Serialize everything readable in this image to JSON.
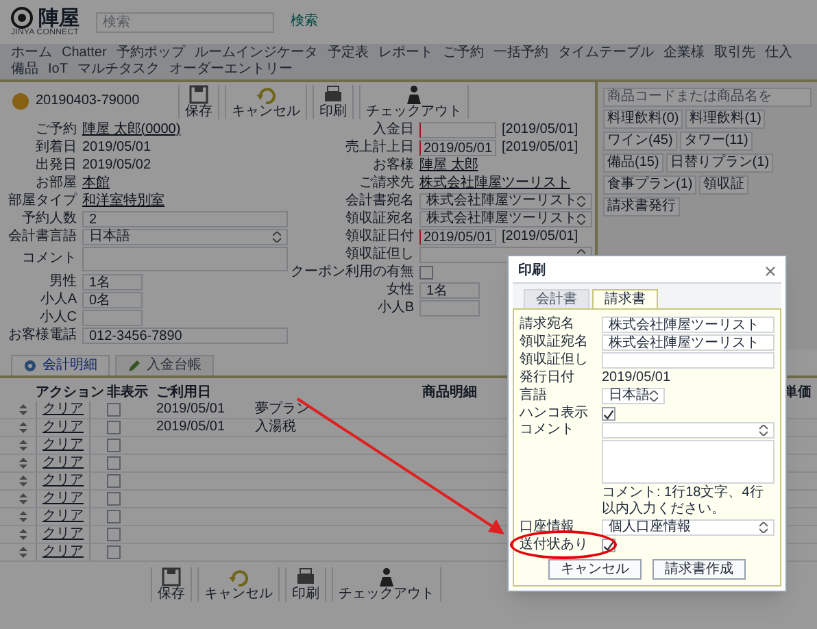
{
  "header": {
    "logo_text": "陣屋",
    "logo_subtitle": "JINYA CONNECT",
    "search": {
      "placeholder": "検索"
    },
    "search_button": "検索"
  },
  "nav": [
    "ホーム",
    "Chatter",
    "予約ポップ",
    "ルームインジケータ",
    "予定表",
    "レポート",
    "ご予約",
    "一括予約",
    "タイムテーブル",
    "企業様",
    "取引先",
    "仕入",
    "備品",
    "IoT",
    "マルチタスク",
    "オーダーエントリー"
  ],
  "record": {
    "number": "20190403-79000"
  },
  "toolbar": [
    "保存",
    "キャンセル",
    "印刷",
    "チェックアウト"
  ],
  "form_left": [
    {
      "label": "ご予約",
      "kind": "link",
      "value": "陣屋 太郎(0000)"
    },
    {
      "label": "到着日",
      "kind": "text",
      "value": "2019/05/01"
    },
    {
      "label": "出発日",
      "kind": "text",
      "value": "2019/05/02"
    },
    {
      "label": "お部屋",
      "kind": "link",
      "value": "本館"
    },
    {
      "label": "部屋タイプ",
      "kind": "link",
      "value": "和洋室特別室"
    },
    {
      "label": "予約人数",
      "kind": "input",
      "value": "2"
    },
    {
      "label": "会計書言語",
      "kind": "select",
      "value": "日本語"
    },
    {
      "label": "コメント",
      "kind": "textarea"
    },
    {
      "label": "男性",
      "kind": "input",
      "value": "1名"
    },
    {
      "label": "小人A",
      "kind": "input",
      "value": "0名"
    },
    {
      "label": "小人C",
      "kind": "input"
    },
    {
      "label": "お客様電話",
      "kind": "input",
      "value": "012-3456-7890"
    }
  ],
  "form_right": [
    {
      "label": "入金日",
      "kind": "date",
      "button": "[2019/05/01]"
    },
    {
      "label": "売上計上日",
      "kind": "date",
      "value": "2019/05/01",
      "button": "[2019/05/01]"
    },
    {
      "label": "お客様",
      "kind": "link",
      "value": "陣屋 太郎"
    },
    {
      "label": "ご請求先",
      "kind": "link",
      "value": "株式会社陣屋ツーリスト"
    },
    {
      "label": "会計書宛名",
      "kind": "select",
      "value": "株式会社陣屋ツーリスト"
    },
    {
      "label": "領収証宛名",
      "kind": "select",
      "value": "株式会社陣屋ツーリスト"
    },
    {
      "label": "領収証日付",
      "kind": "date",
      "value": "2019/05/01",
      "button": "[2019/05/01]"
    },
    {
      "label": "領収証但し",
      "kind": "select"
    },
    {
      "label": "クーポン利用の有無",
      "kind": "checkbox",
      "checked": false
    },
    {
      "label": "女性",
      "kind": "input",
      "value": "1名"
    },
    {
      "label": "小人B",
      "kind": "input"
    }
  ],
  "product_panel": {
    "hint": "商品コードまたは商品名を",
    "buttons": [
      "料理飲料(0)",
      "料理飲料(1)",
      "ワイン(45)",
      "タワー(11)",
      "備品(15)",
      "日替りプラン(1)",
      "食事プラン(1)",
      "領収証",
      "請求書発行"
    ]
  },
  "detail_tabs": [
    {
      "label": "会計明細",
      "selected": true
    },
    {
      "label": "入金台帳",
      "selected": false
    }
  ],
  "table": {
    "columns": [
      "アクション",
      "非表示",
      "ご利用日",
      "商品明細",
      "単価"
    ],
    "rows": [
      {
        "action": "クリア",
        "hidden": false,
        "date": "2019/05/01",
        "item": "夢プラン"
      },
      {
        "action": "クリア",
        "hidden": false,
        "date": "2019/05/01",
        "item": "入湯税"
      },
      {
        "action": "クリア",
        "hidden": false
      },
      {
        "action": "クリア",
        "hidden": false
      },
      {
        "action": "クリア",
        "hidden": false
      },
      {
        "action": "クリア",
        "hidden": false
      },
      {
        "action": "クリア",
        "hidden": false
      },
      {
        "action": "クリア",
        "hidden": false
      },
      {
        "action": "クリア",
        "hidden": false
      }
    ]
  },
  "bottom_toolbar": [
    "保存",
    "キャンセル",
    "印刷",
    "チェックアウト"
  ],
  "dialog": {
    "title": "印刷",
    "tabs": [
      {
        "label": "会計書",
        "selected": false
      },
      {
        "label": "請求書",
        "selected": true
      }
    ],
    "fields": [
      {
        "label": "請求宛名",
        "kind": "input",
        "value": "株式会社陣屋ツーリスト"
      },
      {
        "label": "領収証宛名",
        "kind": "input",
        "value": "株式会社陣屋ツーリスト"
      },
      {
        "label": "領収証但し",
        "kind": "input"
      },
      {
        "label": "発行日付",
        "kind": "text",
        "value": "2019/05/01"
      },
      {
        "label": "言語",
        "kind": "select",
        "value": "日本語"
      },
      {
        "label": "ハンコ表示",
        "kind": "checkbox",
        "checked": true
      },
      {
        "label": "コメント",
        "kind": "comment",
        "note": "コメント: 1行18文字、4行以内入力ください。"
      },
      {
        "label": "口座情報",
        "kind": "select",
        "value": "個人口座情報"
      },
      {
        "label": "送付状あり",
        "kind": "checkbox",
        "checked": true,
        "highlighted": true
      }
    ],
    "buttons": [
      "キャンセル",
      "請求書作成"
    ]
  }
}
